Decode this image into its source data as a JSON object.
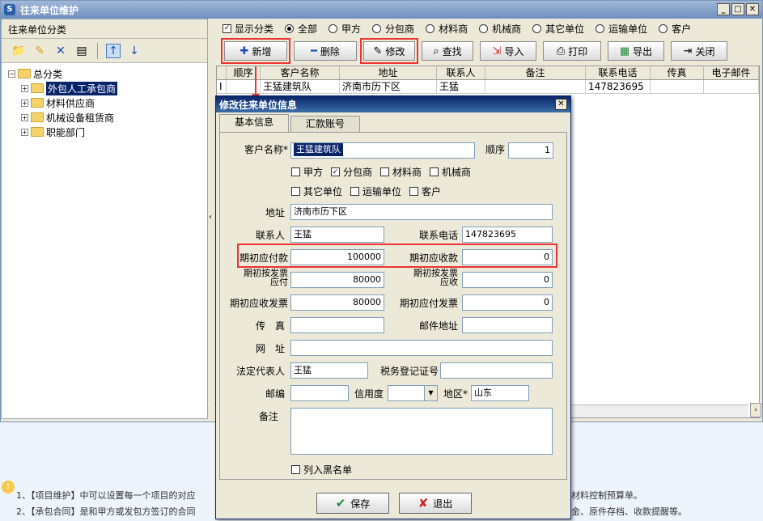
{
  "window": {
    "title": "往来单位维护",
    "btn_min": "_",
    "btn_max": "□",
    "btn_close": "✕"
  },
  "left": {
    "header": "往来单位分类",
    "tree": {
      "root": "总分类",
      "items": [
        "外包人工承包商",
        "材料供应商",
        "机械设备租赁商",
        "职能部门"
      ]
    }
  },
  "filter": {
    "show_category": "显示分类",
    "options": [
      "全部",
      "甲方",
      "分包商",
      "材料商",
      "机械商",
      "其它单位",
      "运输单位",
      "客户"
    ],
    "selected": "全部"
  },
  "toolbar": {
    "add": "新增",
    "delete": "删除",
    "edit": "修改",
    "search": "查找",
    "import": "导入",
    "print": "打印",
    "export": "导出",
    "close": "关闭"
  },
  "grid": {
    "columns": [
      "顺序",
      "客户名称",
      "地址",
      "联系人",
      "备注",
      "联系电话",
      "传真",
      "电子邮件"
    ],
    "rows": [
      {
        "marker": "I",
        "order": "",
        "name": "王猛建筑队",
        "address": "济南市历下区",
        "contact": "王猛",
        "remark": "",
        "phone": "147823695",
        "fax": "",
        "email": ""
      }
    ]
  },
  "dialog": {
    "title": "修改往来单位信息",
    "tabs": [
      "基本信息",
      "汇款账号"
    ],
    "labels": {
      "name": "客户名称*",
      "order": "顺序",
      "address": "地址",
      "contact": "联系人",
      "phone": "联系电话",
      "init_payable": "期初应付款",
      "init_receivable": "期初应收款",
      "inv_payable": "期初按发票应付",
      "inv_receivable": "期初按发票应收",
      "init_recv_invoice": "期初应收发票",
      "init_pay_invoice": "期初应付发票",
      "fax": "传　真",
      "postal": "邮件地址",
      "web": "网　址",
      "legal_rep": "法定代表人",
      "tax_no": "税务登记证号",
      "zip": "邮编",
      "credit": "信用度",
      "region": "地区*",
      "remark": "备注",
      "blacklist": "列入黑名单"
    },
    "types_row1": [
      "甲方",
      "分包商",
      "材料商",
      "机械商"
    ],
    "types_row2": [
      "其它单位",
      "运输单位",
      "客户"
    ],
    "values": {
      "name": "王猛建筑队",
      "order": "1",
      "address": "济南市历下区",
      "contact": "王猛",
      "phone": "147823695",
      "init_payable": "100000",
      "init_receivable": "0",
      "inv_payable": "80000",
      "inv_receivable": "0",
      "init_recv_invoice": "80000",
      "init_pay_invoice": "0",
      "fax": "",
      "postal": "",
      "web": "",
      "legal_rep": "王猛",
      "tax_no": "",
      "zip": "",
      "credit": "",
      "region": "山东",
      "remark": ""
    },
    "checked_types": [
      "分包商"
    ],
    "btn_save": "保存",
    "btn_exit": "退出"
  },
  "notes": {
    "line1_left": "1、【项目维护】中可以设置每一个项目的对应",
    "line1_right": "材料控制预算单。",
    "line2_left": "2、【承包合同】是和甲方或发包方签订的合同",
    "line2_right": "金、原件存档、收款提醒等。"
  }
}
